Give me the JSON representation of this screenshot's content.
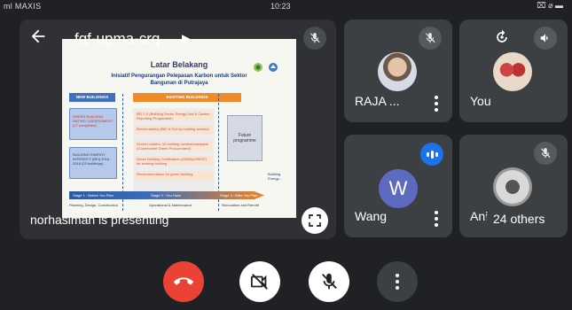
{
  "status_bar": {
    "carrier": "ml MAXIS",
    "time": "10:23",
    "right": "⌧ ⌀ ▬"
  },
  "main_tile": {
    "meeting_code": "fqf-upma-crq",
    "presenting_text": "norhasiman is presenting",
    "slide": {
      "title": "Latar Belakang",
      "subtitle": "Inisiatif Pengurangan Pelepasan Karbon untuk Sektor Bangunan di Putrajaya",
      "new_building_header": "NEW BUILDINGS",
      "existing_building_header": "EXISTING BUILDINGS",
      "new_box1": "GREEN BUILDING RATING / ASSESSMENT (17 completed)",
      "new_box2": "BUILDING ENERGY INTENSITY (BEI) 2016 - 2018 (23 buildings)",
      "exist_items": [
        "BEI 1.0 (Building Sector Energy Use & Carbon Reporting Programme)",
        "Benchmarking (BEI & EUI by building sectors)",
        "Green Leaders: 16 building owners/managers (Government Green Procurement)",
        "Green Building Certification (GBI/MyCREST) for existing building",
        "Recommendation for green building"
      ],
      "future_box": "Future programme",
      "arrow_step1": "Stage 1 : Before You Plan",
      "arrow_step2": "Stage 2 : You Have",
      "arrow_step3": "Stage 3 : After You Plan",
      "foot_left": "Planning, Design, Construction",
      "foot_mid": "Operational & Maintenance",
      "foot_right": "Renovation and Retrofit",
      "side_note": "Building Energy..."
    }
  },
  "participants": [
    {
      "name": "RAJA ...",
      "muted": true
    },
    {
      "name": "You",
      "muted": false
    },
    {
      "name": "Wang",
      "avatar_letter": "W",
      "speaking": true
    },
    {
      "name": "Ani",
      "muted": true,
      "others_label": "24 others"
    }
  ],
  "controls": {
    "end_call": "end-call",
    "camera": "camera-off",
    "mic": "mic-off",
    "more": "more-options"
  },
  "colors": {
    "background": "#202124",
    "tile": "#3c4043",
    "end_call_red": "#ea4335",
    "avatar_purple": "#5c6bc0",
    "speaking_blue": "#1a73e8"
  }
}
